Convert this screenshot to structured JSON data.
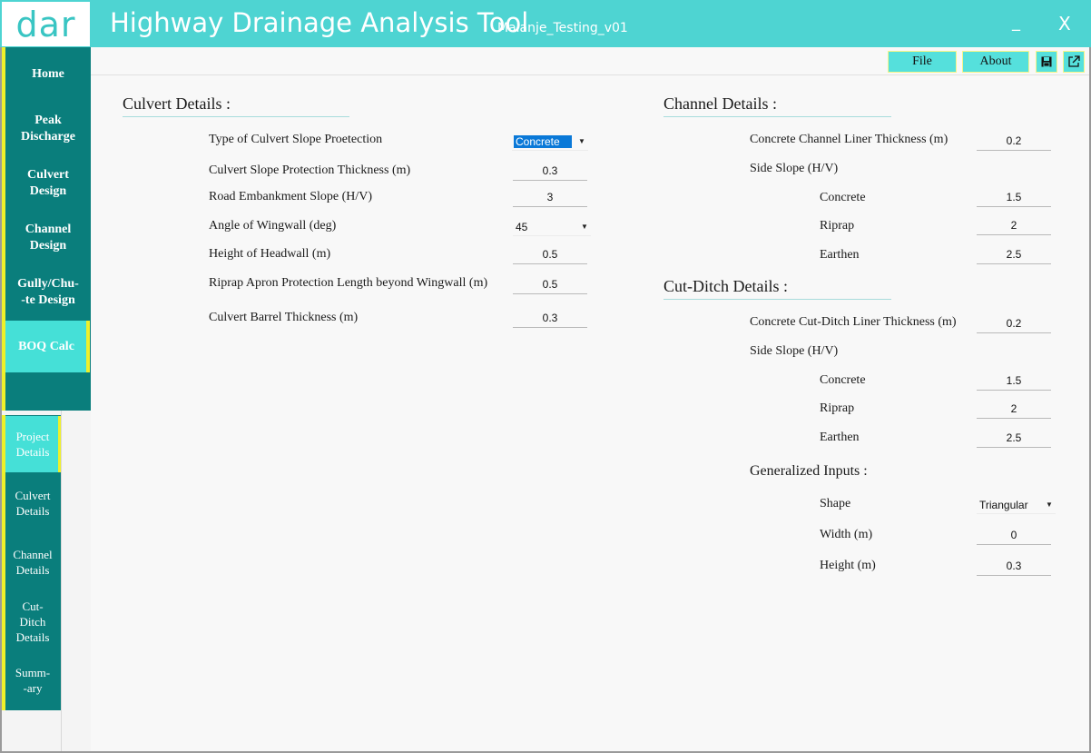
{
  "titlebar": {
    "logo": "dar",
    "app_title": "Highway Drainage Analysis Tool",
    "project_name": "Malanje_Testing_v01",
    "minimize": "_",
    "close": "X"
  },
  "toolbar": {
    "file_label": "File",
    "about_label": "About",
    "save_icon": "save-icon",
    "export_icon": "external-link-icon"
  },
  "nav": {
    "items": [
      {
        "label_l1": "Home",
        "label_l2": ""
      },
      {
        "label_l1": "Peak",
        "label_l2": "Discharge"
      },
      {
        "label_l1": "Culvert",
        "label_l2": "Design"
      },
      {
        "label_l1": "Channel",
        "label_l2": "Design"
      },
      {
        "label_l1": "Gully/Chu-",
        "label_l2": "-te Design"
      },
      {
        "label_l1": "BOQ Calc",
        "label_l2": ""
      }
    ],
    "active": "BOQ Calc"
  },
  "subnav": {
    "items": [
      {
        "l1": "Project",
        "l2": "Details",
        "l3": ""
      },
      {
        "l1": "Culvert",
        "l2": "Details",
        "l3": ""
      },
      {
        "l1": "Channel",
        "l2": "Details",
        "l3": ""
      },
      {
        "l1": "Cut-",
        "l2": "Ditch",
        "l3": "Details"
      },
      {
        "l1": "Summ-",
        "l2": "-ary",
        "l3": ""
      }
    ],
    "active": "Project Details"
  },
  "culvert": {
    "title": "Culvert Details :",
    "slope_protection_type_label": "Type of Culvert Slope Proetection",
    "slope_protection_type_value": "Concrete",
    "slope_protection_thickness_label": "Culvert Slope Protection Thickness (m)",
    "slope_protection_thickness_value": "0.3",
    "embankment_slope_label": "Road Embankment Slope (H/V)",
    "embankment_slope_value": "3",
    "wingwall_angle_label": "Angle of Wingwall (deg)",
    "wingwall_angle_value": "45",
    "headwall_height_label": "Height of Headwall (m)",
    "headwall_height_value": "0.5",
    "riprap_apron_label": "Riprap Apron Protection Length beyond Wingwall (m)",
    "riprap_apron_value": "0.5",
    "barrel_thickness_label": "Culvert Barrel Thickness (m)",
    "barrel_thickness_value": "0.3"
  },
  "channel": {
    "title": "Channel Details :",
    "liner_thickness_label": "Concrete Channel Liner Thickness (m)",
    "liner_thickness_value": "0.2",
    "side_slope_label": "Side Slope (H/V)",
    "concrete_label": "Concrete",
    "concrete_value": "1.5",
    "riprap_label": "Riprap",
    "riprap_value": "2",
    "earthen_label": "Earthen",
    "earthen_value": "2.5"
  },
  "cut_ditch": {
    "title": "Cut-Ditch Details :",
    "liner_thickness_label": "Concrete Cut-Ditch Liner Thickness (m)",
    "liner_thickness_value": "0.2",
    "side_slope_label": "Side Slope (H/V)",
    "concrete_label": "Concrete",
    "concrete_value": "1.5",
    "riprap_label": "Riprap",
    "riprap_value": "2",
    "earthen_label": "Earthen",
    "earthen_value": "2.5"
  },
  "generalized": {
    "title": "Generalized Inputs :",
    "shape_label": "Shape",
    "shape_value": "Triangular",
    "width_label": "Width (m)",
    "width_value": "0",
    "height_label": "Height (m)",
    "height_value": "0.3"
  },
  "colors": {
    "titlebar": "#4ed4d2",
    "sidebar": "#0a7e7c",
    "active_nav": "#45e0d7",
    "accent_yellow": "#eef02a"
  }
}
